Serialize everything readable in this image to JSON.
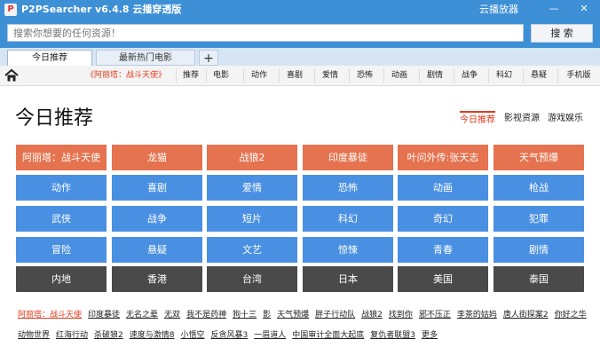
{
  "window": {
    "title": "P2PSearcher v6.4.8 云播穿透版",
    "brand": "云播放器",
    "min_symbol": "—",
    "close_symbol": "✕",
    "icon_letter": "P"
  },
  "search": {
    "placeholder": "搜索你想要的任何资源！",
    "button": "搜 索"
  },
  "tabs": [
    {
      "label": "今日推荐"
    },
    {
      "label": "最新热门电影"
    }
  ],
  "add_tab": "+",
  "nav": {
    "items": [
      "《阿丽塔：战斗天使》",
      "推荐",
      "电影",
      "动作",
      "喜剧",
      "爱情",
      "恐怖",
      "动画",
      "剧情",
      "战争",
      "科幻",
      "悬疑",
      "手机版"
    ]
  },
  "page": {
    "title": "今日推荐",
    "right_tabs": [
      "今日推荐",
      "影视资源",
      "游戏娱乐"
    ]
  },
  "grid": {
    "rows": [
      [
        "阿丽塔：战斗天使",
        "龙猫",
        "战狼2",
        "印度暴徒",
        "叶问外传:张天志",
        "天气预爆"
      ],
      [
        "动作",
        "喜剧",
        "爱情",
        "恐怖",
        "动画",
        "枪战"
      ],
      [
        "武侠",
        "战争",
        "短片",
        "科幻",
        "奇幻",
        "犯罪"
      ],
      [
        "冒险",
        "悬疑",
        "文艺",
        "惊悚",
        "青春",
        "剧情"
      ],
      [
        "内地",
        "香港",
        "台湾",
        "日本",
        "美国",
        "泰国"
      ]
    ],
    "colors": [
      "#e6734f",
      "#4a90e2",
      "#4a90e2",
      "#4a90e2",
      "#4a4a4a"
    ]
  },
  "bottom_links": {
    "line1": [
      "阿丽塔：战斗天使",
      "印度暴徒",
      "无名之辈",
      "无双",
      "我不是药神",
      "狗十三",
      "影",
      "天气预爆",
      "胖子行动队",
      "战狼2",
      "找到你",
      "邪不压正",
      "李茶的姑妈",
      "唐人街探案2",
      "你好之华"
    ],
    "line2": [
      "动物世界",
      "红海行动",
      "杀破狼2",
      "速度与激情8",
      "小悟空",
      "反贪风暴3",
      "一眉道人",
      "中国审计全面大起底",
      "复仇者联盟3",
      "更多"
    ]
  }
}
